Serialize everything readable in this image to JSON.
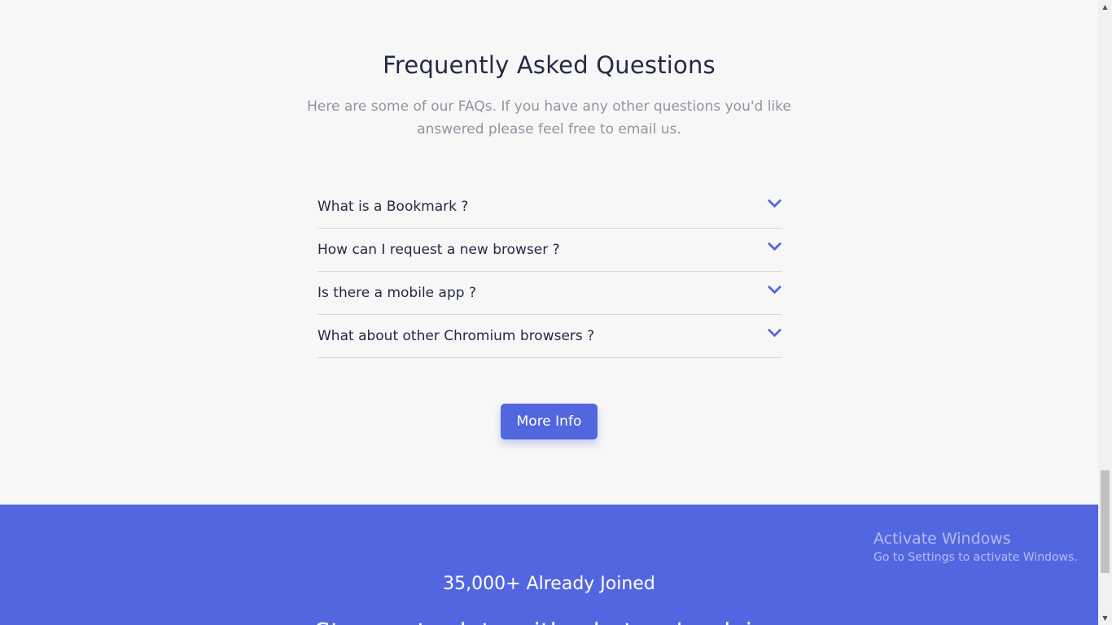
{
  "faq": {
    "title": "Frequently Asked Questions",
    "subtitle": "Here are some of our FAQs. If you have any other questions you'd like answered please feel free to email us.",
    "items": [
      {
        "question": "What is a Bookmark ?"
      },
      {
        "question": "How can I request a new browser ?"
      },
      {
        "question": "Is there a mobile app ?"
      },
      {
        "question": "What about other Chromium browsers ?"
      }
    ],
    "more_info_label": "More Info",
    "icon": "chevron-down-icon"
  },
  "join": {
    "count_text": "35,000+ Already Joined",
    "cut_text": "Stay up-to-date with what we're doing"
  },
  "watermark": {
    "title": "Activate Windows",
    "subtitle": "Go to Settings to activate Windows."
  },
  "colors": {
    "background": "#f7f7f7",
    "accent": "#5267df",
    "heading": "#242a45",
    "muted": "#9194a2",
    "divider": "#d8d9de"
  }
}
